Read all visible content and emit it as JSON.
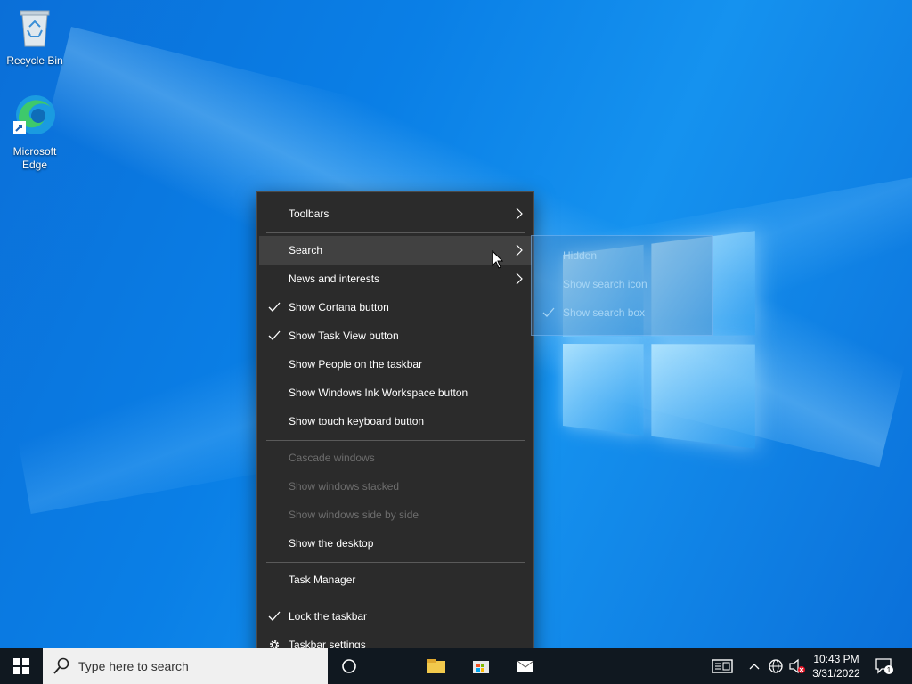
{
  "desktop": {
    "icons": [
      {
        "label": "Recycle Bin",
        "icon": "recycle-bin-icon"
      },
      {
        "label": "Microsoft\nEdge",
        "icon": "edge-icon"
      }
    ]
  },
  "context_menu": {
    "items": [
      {
        "label": "Toolbars",
        "submenu": true
      },
      {
        "label": "Search",
        "submenu": true,
        "highlighted": true
      },
      {
        "label": "News and interests",
        "submenu": true
      },
      {
        "label": "Show Cortana button",
        "checked": true
      },
      {
        "label": "Show Task View button",
        "checked": true
      },
      {
        "label": "Show People on the taskbar"
      },
      {
        "label": "Show Windows Ink Workspace button"
      },
      {
        "label": "Show touch keyboard button"
      },
      {
        "label": "Cascade windows",
        "disabled": true
      },
      {
        "label": "Show windows stacked",
        "disabled": true
      },
      {
        "label": "Show windows side by side",
        "disabled": true
      },
      {
        "label": "Show the desktop"
      },
      {
        "label": "Task Manager"
      },
      {
        "label": "Lock the taskbar",
        "checked": true
      },
      {
        "label": "Taskbar settings",
        "icon": "gear-icon"
      }
    ]
  },
  "search_submenu": {
    "items": [
      {
        "label": "Hidden"
      },
      {
        "label": "Show search icon"
      },
      {
        "label": "Show search box",
        "checked": true
      }
    ]
  },
  "taskbar": {
    "search_placeholder": "Type here to search",
    "clock": {
      "time": "10:43 PM",
      "date": "3/31/2022"
    },
    "notification_count": "1",
    "colors": {
      "taskbar": "#101820",
      "menu": "#2b2b2b",
      "accent": "#0a7fe6"
    }
  }
}
